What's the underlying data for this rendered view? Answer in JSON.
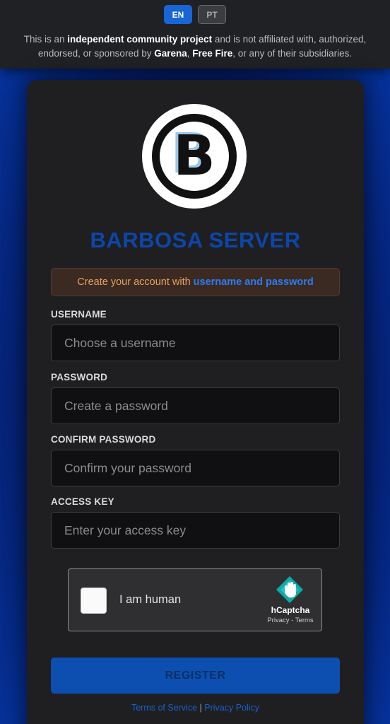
{
  "header": {
    "languages": [
      {
        "code": "EN",
        "active": true
      },
      {
        "code": "PT",
        "active": false
      }
    ],
    "disclaimer": {
      "t1": "This is an ",
      "b1": "independent community project",
      "t2": " and is not affiliated with, authorized, endorsed, or sponsored by ",
      "b2": "Garena",
      "t3": ", ",
      "b3": "Free Fire",
      "t4": ", or any of their subsidiaries."
    }
  },
  "logo": {
    "letter": "B"
  },
  "brand": {
    "name": "BARBOSA SERVER",
    "color": "#0d46a8"
  },
  "notice": {
    "text": "Create your account with",
    "highlight": "username and password"
  },
  "form": {
    "username": {
      "label": "USERNAME",
      "placeholder": "Choose a username",
      "value": ""
    },
    "password": {
      "label": "PASSWORD",
      "placeholder": "Create a password",
      "value": ""
    },
    "confirm": {
      "label": "CONFIRM PASSWORD",
      "placeholder": "Confirm your password",
      "value": ""
    },
    "access_key": {
      "label": "ACCESS KEY",
      "placeholder": "Enter your access key",
      "value": ""
    }
  },
  "captcha": {
    "label": "I am human",
    "brand": "hCaptcha",
    "privacy": "Privacy",
    "separator": " - ",
    "terms": "Terms",
    "icon": "hcaptcha-hand-icon"
  },
  "register": {
    "label": "REGISTER"
  },
  "footer": {
    "terms": "Terms of Service",
    "separator": " | ",
    "privacy": "Privacy Policy"
  },
  "colors": {
    "accent": "#1865d6",
    "notice_text": "#e9a060",
    "link": "#1a5fcc"
  }
}
